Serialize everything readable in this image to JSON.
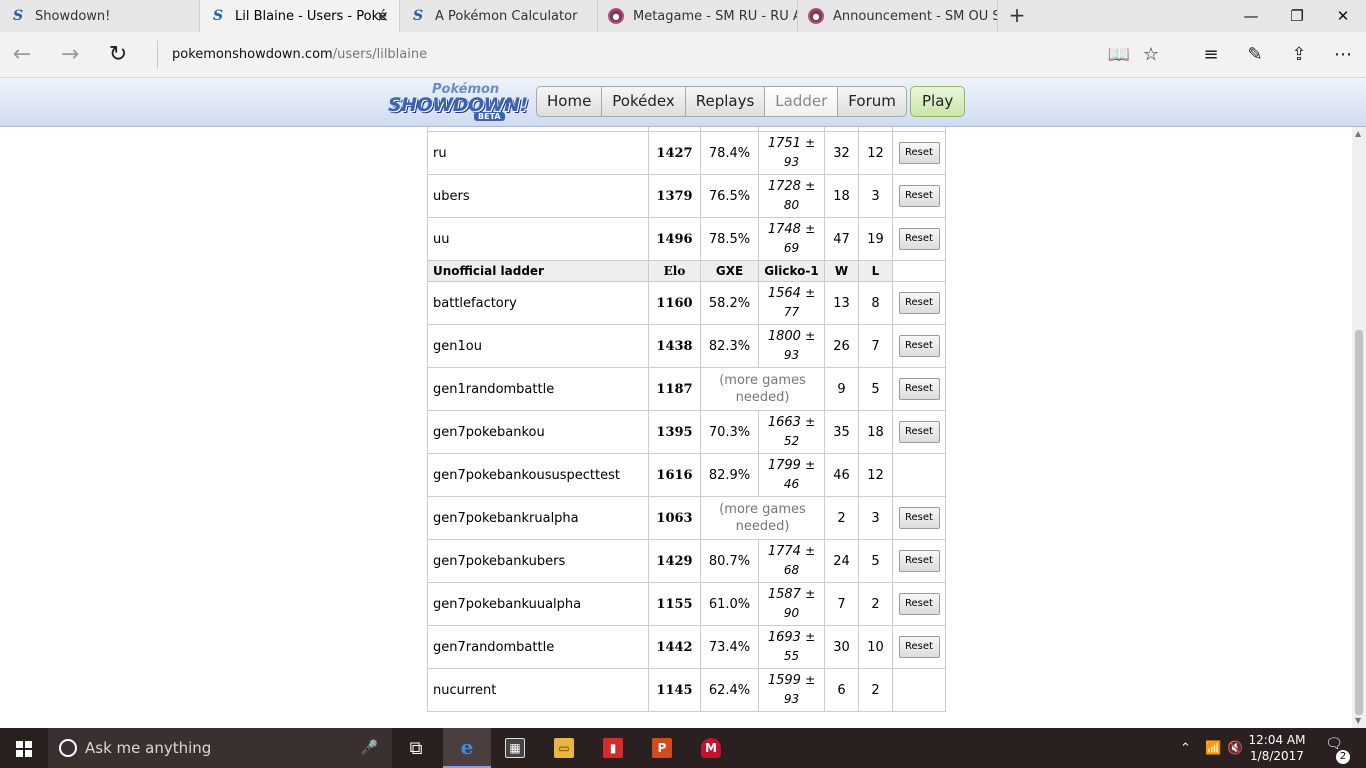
{
  "browser": {
    "tabs": [
      {
        "title": "Showdown!",
        "icon": "showdown-logo-icon"
      },
      {
        "title": "Lil Blaine - Users - Poké",
        "icon": "showdown-logo-icon",
        "active": true
      },
      {
        "title": "A Pokémon Calculator",
        "icon": "showdown-logo-icon"
      },
      {
        "title": "Metagame - SM RU - RU Al",
        "icon": "pokeball-icon"
      },
      {
        "title": "Announcement - SM OU Su",
        "icon": "pokeball-icon"
      }
    ],
    "url_domain": "pokemonshowdown.com",
    "url_path": "/users/lilblaine"
  },
  "header": {
    "logo_top": "Pokémon",
    "logo_main": "SHOWDOWN!",
    "logo_badge": "BETA",
    "nav": [
      "Home",
      "Pokédex",
      "Replays",
      "Ladder",
      "Forum"
    ],
    "current_nav": "Ladder",
    "play_label": "Play"
  },
  "ladder": {
    "partial_glicko_dev": "93",
    "official_rows": [
      {
        "format": "ru",
        "elo": "1427",
        "gxe": "78.4%",
        "glicko": "1751",
        "dev": "93",
        "w": "32",
        "l": "12",
        "reset": true
      },
      {
        "format": "ubers",
        "elo": "1379",
        "gxe": "76.5%",
        "glicko": "1728",
        "dev": "80",
        "w": "18",
        "l": "3",
        "reset": true
      },
      {
        "format": "uu",
        "elo": "1496",
        "gxe": "78.5%",
        "glicko": "1748",
        "dev": "69",
        "w": "47",
        "l": "19",
        "reset": true
      }
    ],
    "unofficial_header": {
      "label": "Unofficial ladder",
      "elo": "Elo",
      "gxe": "GXE",
      "glicko": "Glicko-1",
      "w": "W",
      "l": "L"
    },
    "unofficial_rows": [
      {
        "format": "battlefactory",
        "elo": "1160",
        "gxe": "58.2%",
        "glicko": "1564",
        "dev": "77",
        "w": "13",
        "l": "8",
        "reset": true
      },
      {
        "format": "gen1ou",
        "elo": "1438",
        "gxe": "82.3%",
        "glicko": "1800",
        "dev": "93",
        "w": "26",
        "l": "7",
        "reset": true
      },
      {
        "format": "gen1randombattle",
        "elo": "1187",
        "more": "(more games needed)",
        "w": "9",
        "l": "5",
        "reset": true
      },
      {
        "format": "gen7pokebankou",
        "elo": "1395",
        "gxe": "70.3%",
        "glicko": "1663",
        "dev": "52",
        "w": "35",
        "l": "18",
        "reset": true
      },
      {
        "format": "gen7pokebankoususpecttest",
        "elo": "1616",
        "gxe": "82.9%",
        "glicko": "1799",
        "dev": "46",
        "w": "46",
        "l": "12",
        "reset": false
      },
      {
        "format": "gen7pokebankrualpha",
        "elo": "1063",
        "more": "(more games needed)",
        "w": "2",
        "l": "3",
        "reset": true
      },
      {
        "format": "gen7pokebankubers",
        "elo": "1429",
        "gxe": "80.7%",
        "glicko": "1774",
        "dev": "68",
        "w": "24",
        "l": "5",
        "reset": true
      },
      {
        "format": "gen7pokebankuualpha",
        "elo": "1155",
        "gxe": "61.0%",
        "glicko": "1587",
        "dev": "90",
        "w": "7",
        "l": "2",
        "reset": true
      },
      {
        "format": "gen7randombattle",
        "elo": "1442",
        "gxe": "73.4%",
        "glicko": "1693",
        "dev": "55",
        "w": "30",
        "l": "10",
        "reset": true
      },
      {
        "format": "nucurrent",
        "elo": "1145",
        "gxe": "62.4%",
        "glicko": "1599",
        "dev": "93",
        "w": "6",
        "l": "2",
        "reset": false
      }
    ],
    "reset_label": "Reset",
    "plus_minus": "±"
  },
  "taskbar": {
    "search_placeholder": "Ask me anything",
    "time": "12:04 AM",
    "date": "1/8/2017",
    "notification_count": "2"
  }
}
